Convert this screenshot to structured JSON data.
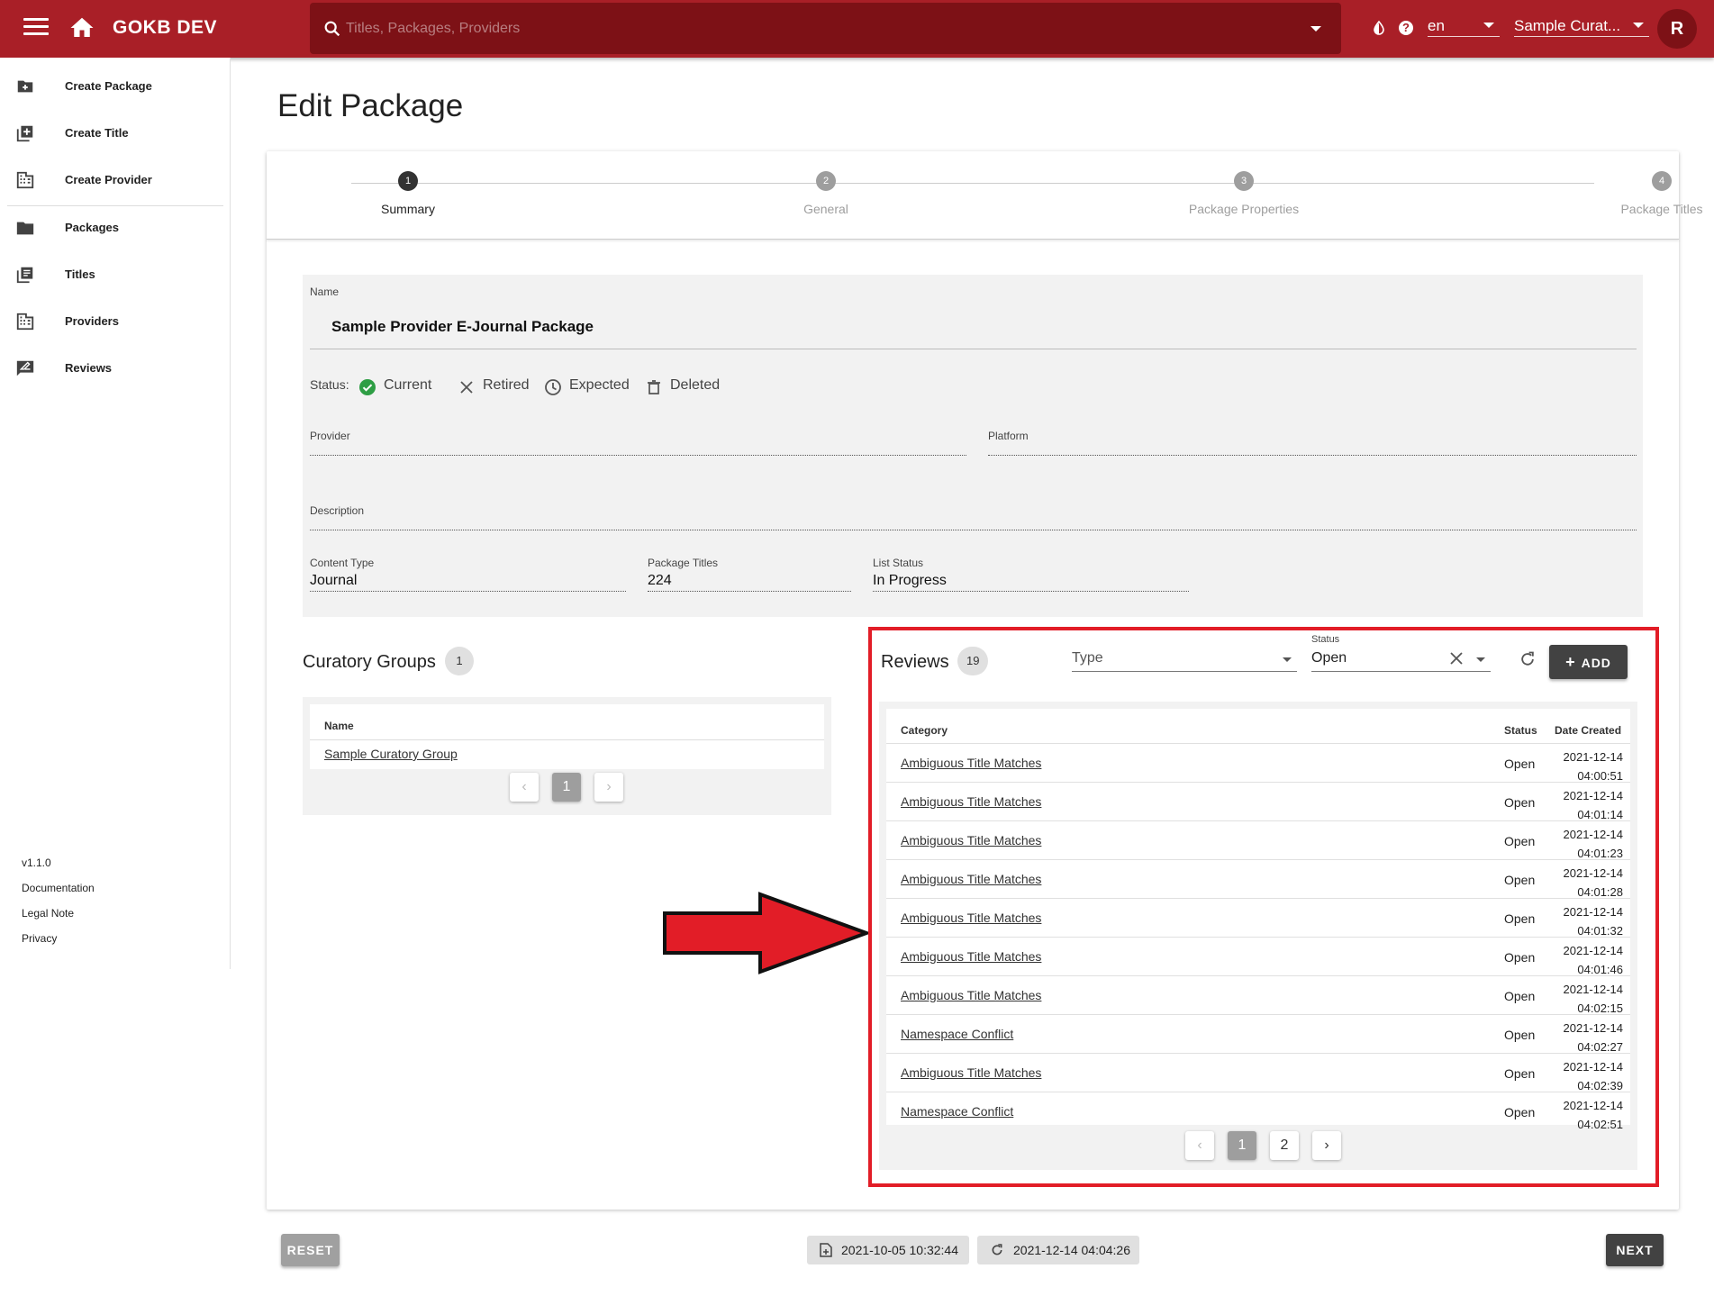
{
  "appbar": {
    "brand": "GOKB DEV",
    "search_placeholder": "Titles, Packages, Providers",
    "language": "en",
    "group": "Sample Curat...",
    "avatar": "R",
    "color": "#a91f27"
  },
  "sidebar": {
    "items": [
      {
        "label": "Create Package",
        "icon": "create-package-icon"
      },
      {
        "label": "Create Title",
        "icon": "create-title-icon"
      },
      {
        "label": "Create Provider",
        "icon": "create-provider-icon"
      },
      {
        "label": "Packages",
        "icon": "folder-icon"
      },
      {
        "label": "Titles",
        "icon": "titles-icon"
      },
      {
        "label": "Providers",
        "icon": "providers-icon"
      },
      {
        "label": "Reviews",
        "icon": "reviews-icon"
      }
    ],
    "footer": {
      "version": "v1.1.0",
      "documentation": "Documentation",
      "legal": "Legal Note",
      "privacy": "Privacy"
    }
  },
  "page": {
    "title": "Edit Package"
  },
  "stepper": {
    "steps": [
      {
        "num": "1",
        "label": "Summary"
      },
      {
        "num": "2",
        "label": "General"
      },
      {
        "num": "3",
        "label": "Package Properties"
      },
      {
        "num": "4",
        "label": "Package Titles"
      }
    ],
    "active": 0
  },
  "form": {
    "name_label": "Name",
    "name_value": "Sample Provider E-Journal Package",
    "status_label": "Status:",
    "status_options": [
      "Current",
      "Retired",
      "Expected",
      "Deleted"
    ],
    "status_selected": "Current",
    "provider_label": "Provider",
    "platform_label": "Platform",
    "description_label": "Description",
    "content_type_label": "Content Type",
    "content_type_value": "Journal",
    "package_titles_label": "Package Titles",
    "package_titles_value": "224",
    "list_status_label": "List Status",
    "list_status_value": "In Progress"
  },
  "curatory_groups": {
    "title": "Curatory Groups",
    "count": "1",
    "column": "Name",
    "rows": [
      "Sample Curatory Group"
    ],
    "pagination": {
      "pages": [
        "1"
      ],
      "current": "1"
    }
  },
  "reviews": {
    "title": "Reviews",
    "count": "19",
    "type_placeholder": "Type",
    "status_label": "Status",
    "status_value": "Open",
    "add_label": "ADD",
    "columns": {
      "category": "Category",
      "status": "Status",
      "date": "Date Created"
    },
    "rows": [
      {
        "category": "Ambiguous Title Matches",
        "status": "Open",
        "date": "2021-12-14",
        "time": "04:00:51"
      },
      {
        "category": "Ambiguous Title Matches",
        "status": "Open",
        "date": "2021-12-14",
        "time": "04:01:14"
      },
      {
        "category": "Ambiguous Title Matches",
        "status": "Open",
        "date": "2021-12-14",
        "time": "04:01:23"
      },
      {
        "category": "Ambiguous Title Matches",
        "status": "Open",
        "date": "2021-12-14",
        "time": "04:01:28"
      },
      {
        "category": "Ambiguous Title Matches",
        "status": "Open",
        "date": "2021-12-14",
        "time": "04:01:32"
      },
      {
        "category": "Ambiguous Title Matches",
        "status": "Open",
        "date": "2021-12-14",
        "time": "04:01:46"
      },
      {
        "category": "Ambiguous Title Matches",
        "status": "Open",
        "date": "2021-12-14",
        "time": "04:02:15"
      },
      {
        "category": "Namespace Conflict",
        "status": "Open",
        "date": "2021-12-14",
        "time": "04:02:27"
      },
      {
        "category": "Ambiguous Title Matches",
        "status": "Open",
        "date": "2021-12-14",
        "time": "04:02:39"
      },
      {
        "category": "Namespace Conflict",
        "status": "Open",
        "date": "2021-12-14",
        "time": "04:02:51"
      }
    ],
    "pagination": {
      "pages": [
        "1",
        "2"
      ],
      "current": "1"
    }
  },
  "footer": {
    "reset_label": "RESET",
    "created": "2021-10-05 10:32:44",
    "updated": "2021-12-14 04:04:26",
    "next_label": "NEXT"
  },
  "annotation": {
    "color": "#e21d27"
  }
}
